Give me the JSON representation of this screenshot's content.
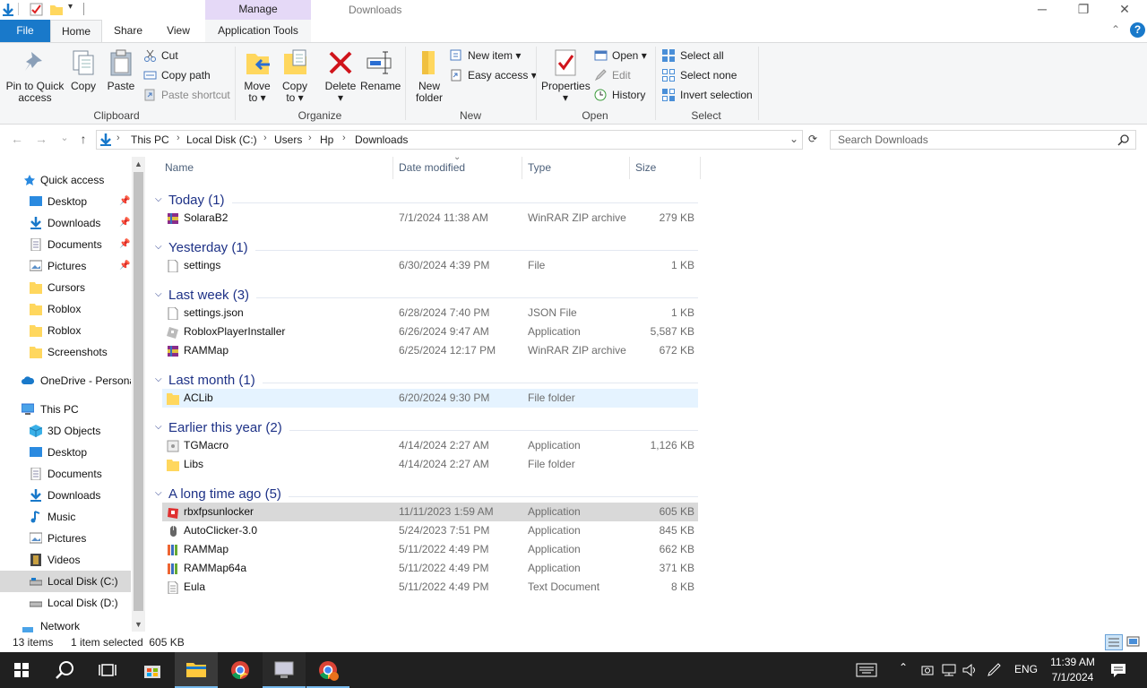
{
  "window": {
    "title": "Downloads",
    "manage_tab": "Manage",
    "controls": {
      "minimize": "─",
      "maximize": "❐",
      "close": "✕"
    }
  },
  "tabs": {
    "file": "File",
    "home": "Home",
    "share": "Share",
    "view": "View",
    "app_tools": "Application Tools"
  },
  "ribbon": {
    "clipboard": {
      "label": "Clipboard",
      "pin_line1": "Pin to Quick",
      "pin_line2": "access",
      "copy": "Copy",
      "paste": "Paste",
      "cut": "Cut",
      "copy_path": "Copy path",
      "paste_shortcut": "Paste shortcut"
    },
    "organize": {
      "label": "Organize",
      "move_line1": "Move",
      "move_line2": "to ▾",
      "copyto_line1": "Copy",
      "copyto_line2": "to ▾",
      "delete": "Delete",
      "delete_arrow": "▾",
      "rename": "Rename"
    },
    "new": {
      "label": "New",
      "folder_line1": "New",
      "folder_line2": "folder",
      "new_item": "New item ▾",
      "easy_access": "Easy access ▾"
    },
    "open": {
      "label": "Open",
      "properties": "Properties",
      "properties_arrow": "▾",
      "open": "Open ▾",
      "edit": "Edit",
      "history": "History"
    },
    "select": {
      "label": "Select",
      "select_all": "Select all",
      "select_none": "Select none",
      "invert": "Invert selection"
    },
    "collapse": "⌃",
    "help": "?"
  },
  "address": {
    "back": "←",
    "forward": "→",
    "recent": "⌄",
    "up": "↑",
    "crumbs": [
      "This PC",
      "Local Disk (C:)",
      "Users",
      "Hp",
      "Downloads"
    ],
    "sep": "›",
    "dropdown": "⌄",
    "refresh": "⟳",
    "search_placeholder": "Search Downloads"
  },
  "nav": {
    "quick_access": "Quick access",
    "qa_items": [
      {
        "label": "Desktop",
        "pinned": true
      },
      {
        "label": "Downloads",
        "pinned": true
      },
      {
        "label": "Documents",
        "pinned": true
      },
      {
        "label": "Pictures",
        "pinned": true
      },
      {
        "label": "Cursors",
        "pinned": false
      },
      {
        "label": "Roblox",
        "pinned": false
      },
      {
        "label": "Roblox",
        "pinned": false
      },
      {
        "label": "Screenshots",
        "pinned": false
      }
    ],
    "pin_glyph": "📌",
    "onedrive": "OneDrive - Persona",
    "this_pc": "This PC",
    "pc_items": [
      "3D Objects",
      "Desktop",
      "Documents",
      "Downloads",
      "Music",
      "Pictures",
      "Videos",
      "Local Disk (C:)",
      "Local Disk (D:)"
    ],
    "network": "Network"
  },
  "columns": {
    "name": "Name",
    "date": "Date modified",
    "type": "Type",
    "size": "Size",
    "sort_glyph": "⌄"
  },
  "groups": [
    {
      "label": "Today (1)",
      "files": [
        {
          "name": "SolaraB2",
          "date": "7/1/2024 11:38 AM",
          "type": "WinRAR ZIP archive",
          "size": "279 KB",
          "icon": "winrar-icon"
        }
      ]
    },
    {
      "label": "Yesterday (1)",
      "files": [
        {
          "name": "settings",
          "date": "6/30/2024 4:39 PM",
          "type": "File",
          "size": "1 KB",
          "icon": "file-icon"
        }
      ]
    },
    {
      "label": "Last week (3)",
      "files": [
        {
          "name": "settings.json",
          "date": "6/28/2024 7:40 PM",
          "type": "JSON File",
          "size": "1 KB",
          "icon": "file-icon"
        },
        {
          "name": "RobloxPlayerInstaller",
          "date": "6/26/2024 9:47 AM",
          "type": "Application",
          "size": "5,587 KB",
          "icon": "roblox-icon"
        },
        {
          "name": "RAMMap",
          "date": "6/25/2024 12:17 PM",
          "type": "WinRAR ZIP archive",
          "size": "672 KB",
          "icon": "winrar-icon"
        }
      ]
    },
    {
      "label": "Last month (1)",
      "files": [
        {
          "name": "ACLib",
          "date": "6/20/2024 9:30 PM",
          "type": "File folder",
          "size": "",
          "icon": "folder-icon"
        }
      ]
    },
    {
      "label": "Earlier this year (2)",
      "files": [
        {
          "name": "TGMacro",
          "date": "4/14/2024 2:27 AM",
          "type": "Application",
          "size": "1,126 KB",
          "icon": "app-icon"
        },
        {
          "name": "Libs",
          "date": "4/14/2024 2:27 AM",
          "type": "File folder",
          "size": "",
          "icon": "folder-icon"
        }
      ]
    },
    {
      "label": "A long time ago (5)",
      "files": [
        {
          "name": "rbxfpsunlocker",
          "date": "11/11/2023 1:59 AM",
          "type": "Application",
          "size": "605 KB",
          "icon": "rbxfps-icon"
        },
        {
          "name": "AutoClicker-3.0",
          "date": "5/24/2023 7:51 PM",
          "type": "Application",
          "size": "845 KB",
          "icon": "mouse-icon"
        },
        {
          "name": "RAMMap",
          "date": "5/11/2022 4:49 PM",
          "type": "Application",
          "size": "662 KB",
          "icon": "rammap-icon"
        },
        {
          "name": "RAMMap64a",
          "date": "5/11/2022 4:49 PM",
          "type": "Application",
          "size": "371 KB",
          "icon": "rammap-icon"
        },
        {
          "name": "Eula",
          "date": "5/11/2022 4:49 PM",
          "type": "Text Document",
          "size": "8 KB",
          "icon": "text-file-icon"
        }
      ]
    }
  ],
  "status": {
    "count": "13 items",
    "selected": "1 item selected  605 KB"
  },
  "taskbar": {
    "lang": "ENG",
    "time": "11:39 AM",
    "date": "7/1/2024"
  },
  "colors": {
    "accent": "#1979ca",
    "group_header": "#1e3287",
    "selection": "#d9d9d9",
    "hover": "#e5f3ff",
    "folder": "#ffd75e",
    "taskbar": "#202020"
  }
}
